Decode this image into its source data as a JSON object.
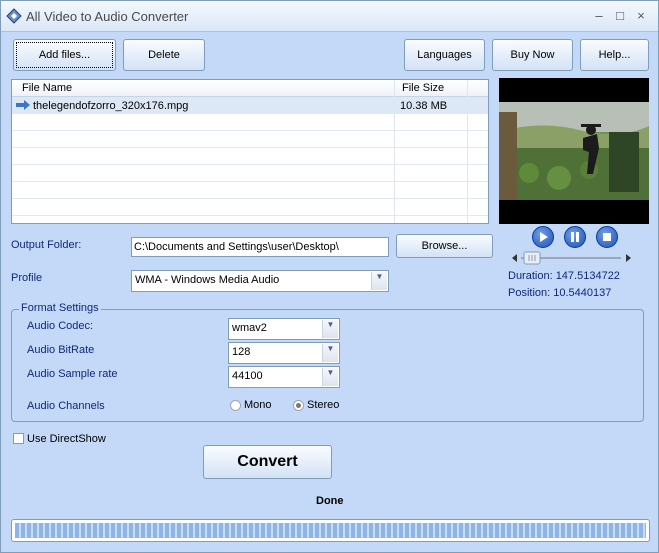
{
  "window": {
    "title": "All Video to Audio Converter",
    "minimize": "‒",
    "maximize": "□",
    "close": "×"
  },
  "toolbar": {
    "add_files": "Add files...",
    "delete": "Delete",
    "languages": "Languages",
    "buy_now": "Buy Now",
    "help": "Help..."
  },
  "file_list": {
    "headers": {
      "name": "File Name",
      "size": "File Size"
    },
    "rows": [
      {
        "name": "thelegendofzorro_320x176.mpg",
        "size": "10.38 MB"
      }
    ]
  },
  "player": {
    "duration_label": "Duration: 147.5134722",
    "position_label": "Position: 10.5440137"
  },
  "output": {
    "label": "Output Folder:",
    "value": "C:\\Documents and Settings\\user\\Desktop\\",
    "browse": "Browse..."
  },
  "profile": {
    "label": "Profile",
    "value": "WMA - Windows Media Audio"
  },
  "format": {
    "title": "Format Settings",
    "codec_label": "Audio Codec:",
    "codec_value": "wmav2",
    "bitrate_label": "Audio BitRate",
    "bitrate_value": "128",
    "samplerate_label": "Audio Sample rate",
    "samplerate_value": "44100",
    "channels_label": "Audio Channels",
    "mono": "Mono",
    "stereo": "Stereo",
    "selected_channel": "Stereo"
  },
  "directshow": {
    "label": "Use DirectShow",
    "checked": false
  },
  "convert": "Convert",
  "status": "Done",
  "progress": 1.0
}
